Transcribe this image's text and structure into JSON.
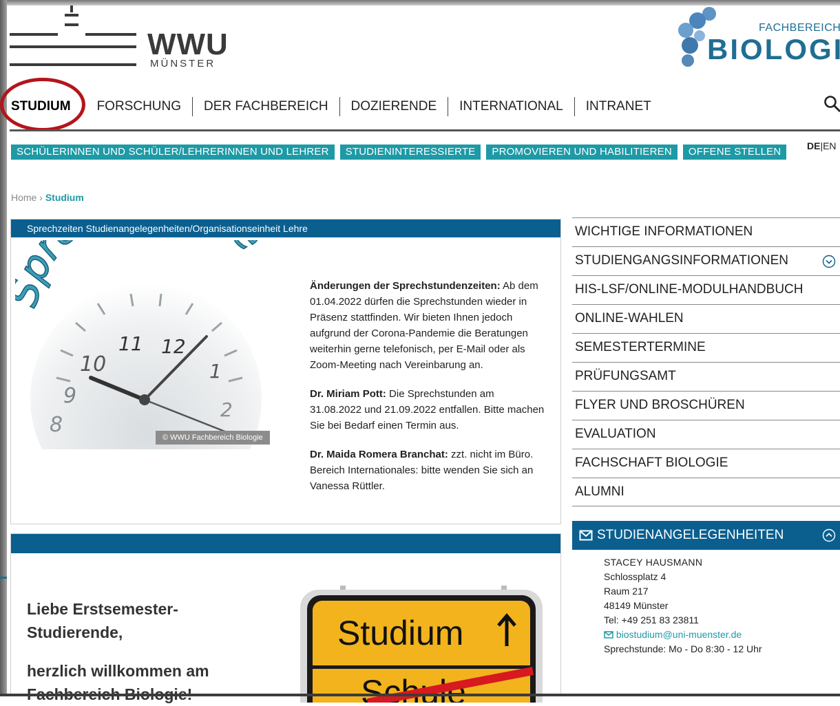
{
  "header": {
    "wwu_wordmark": "WWU",
    "wwu_city": "MÜNSTER",
    "bio_top": "FACHBEREICH",
    "bio_main": "BIOLOGIE"
  },
  "main_nav": {
    "items": [
      "STUDIUM",
      "FORSCHUNG",
      "DER FACHBEREICH",
      "DOZIERENDE",
      "INTERNATIONAL",
      "INTRANET"
    ]
  },
  "sub_nav": {
    "items": [
      "SCHÜLERINNEN UND SCHÜLER/LEHRERINNEN UND LEHRER",
      "STUDIENINTERESSIERTE",
      "PROMOVIEREN UND HABILITIEREN",
      "OFFENE STELLEN"
    ]
  },
  "lang": {
    "de": "DE",
    "sep": "|",
    "en": "EN"
  },
  "breadcrumb": {
    "home": "Home",
    "sep": "›",
    "current": "Studium"
  },
  "box1": {
    "title": "Sprechzeiten Studienangelegenheiten/Organisationseinheit Lehre",
    "image_text": "Sprechstunde",
    "clock_numbers": [
      "8",
      "9",
      "10",
      "11",
      "12",
      "1",
      "2"
    ],
    "credit": "© WWU Fachbereich Biologie",
    "p1_bold": "Änderungen der Sprechstundenzeiten:",
    "p1_text": " Ab dem 01.04.2022 dürfen die Sprechstunden wieder in Präsenz stattfinden. Wir bieten Ihnen jedoch aufgrund der Corona-Pandemie die Beratungen weiterhin gerne telefonisch, per E-Mail oder als Zoom-Meeting nach Vereinbarung an.",
    "p2_bold": "Dr. Miriam Pott:",
    "p2_text": " Die Sprechstunden am 31.08.2022 und 21.09.2022 entfallen. Bitte machen Sie bei Bedarf einen Termin aus.",
    "p3_bold": "Dr. Maida Romera Branchat:",
    "p3_text": " zzt. nicht im Büro. Bereich Internationales: bitte wenden Sie sich an Vanessa Rüttler."
  },
  "box2": {
    "welcome_line1": "Liebe Erstsemester-",
    "welcome_line2": "Studierende,",
    "welcome_line3": "herzlich willkommen am",
    "welcome_line4": "Fachbereich Biologie!",
    "sign_top": "Studium",
    "sign_bottom": "Schule"
  },
  "side_nav": {
    "items": [
      "WICHTIGE INFORMATIONEN",
      "STUDIENGANGSINFORMATIONEN",
      "HIS-LSF/ONLINE-MODULHANDBUCH",
      "ONLINE-WAHLEN",
      "SEMESTERTERMINE",
      "PRÜFUNGSAMT",
      "FLYER UND BROSCHÜREN",
      "EVALUATION",
      "FACHSCHAFT BIOLOGIE",
      "ALUMNI"
    ]
  },
  "contact": {
    "title": "STUDIENANGELEGENHEITEN",
    "name": "STACEY HAUSMANN",
    "street": "Schlossplatz 4",
    "room": "Raum 217",
    "city": "48149 Münster",
    "phone": "Tel: +49 251 83 23811",
    "email": "biostudium@uni-muenster.de",
    "hours": "Sprechstunde: Mo - Do 8:30 - 12 Uhr"
  },
  "colors": {
    "teal": "#1d9aa6",
    "blue_header": "#0a5f8f",
    "highlight_ring": "#b3151a"
  }
}
